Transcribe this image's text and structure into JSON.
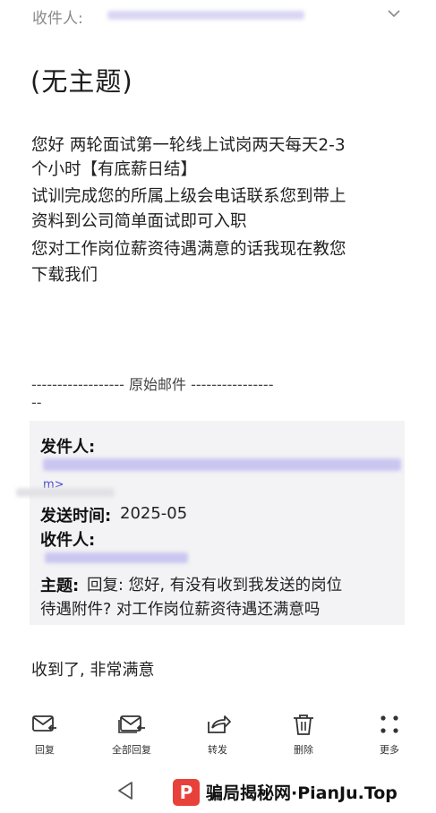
{
  "header": {
    "to_label": "收件人:"
  },
  "subject": "(无主题)",
  "body_lines": [
    "您好 两轮面试第一轮线上试岗两天每天2-3",
    "个小时【有底薪日结】",
    "试训完成您的所属上级会电话联系您到带上",
    "资料到公司简单面试即可入职",
    "您对工作岗位薪资待遇满意的话我现在教您",
    "下载我们"
  ],
  "divider": {
    "line": "------------------ 原始邮件 ----------------",
    "tail": "--"
  },
  "quoted": {
    "sender_label": "发件人:",
    "sender_tail": "m>",
    "sent_time_label": "发送时间:",
    "sent_time_value": "2025-05",
    "recipient_label": "收件人:",
    "subject_label": "主题:",
    "subject_line1": "回复:  您好,  有没有收到我发送的岗位",
    "subject_line2": "待遇附件? 对工作岗位薪资待遇还满意吗"
  },
  "reply_text": "收到了, 非常满意",
  "toolbar": {
    "reply": "回复",
    "reply_all": "全部回复",
    "forward": "转发",
    "delete": "删除",
    "more": "更多"
  },
  "watermark": {
    "badge": "P",
    "text": "骗局揭秘网·PianJu.Top"
  },
  "icons": {
    "chevron": "chevron-down-icon",
    "reply": "reply-icon",
    "reply_all": "reply-all-icon",
    "forward": "forward-icon",
    "delete": "trash-icon",
    "more": "more-dots-icon",
    "back": "back-triangle-icon"
  },
  "colors": {
    "redaction": "#c9c6f0",
    "quote_bg": "#f3f3f5",
    "brand_red": "#e8403a"
  }
}
